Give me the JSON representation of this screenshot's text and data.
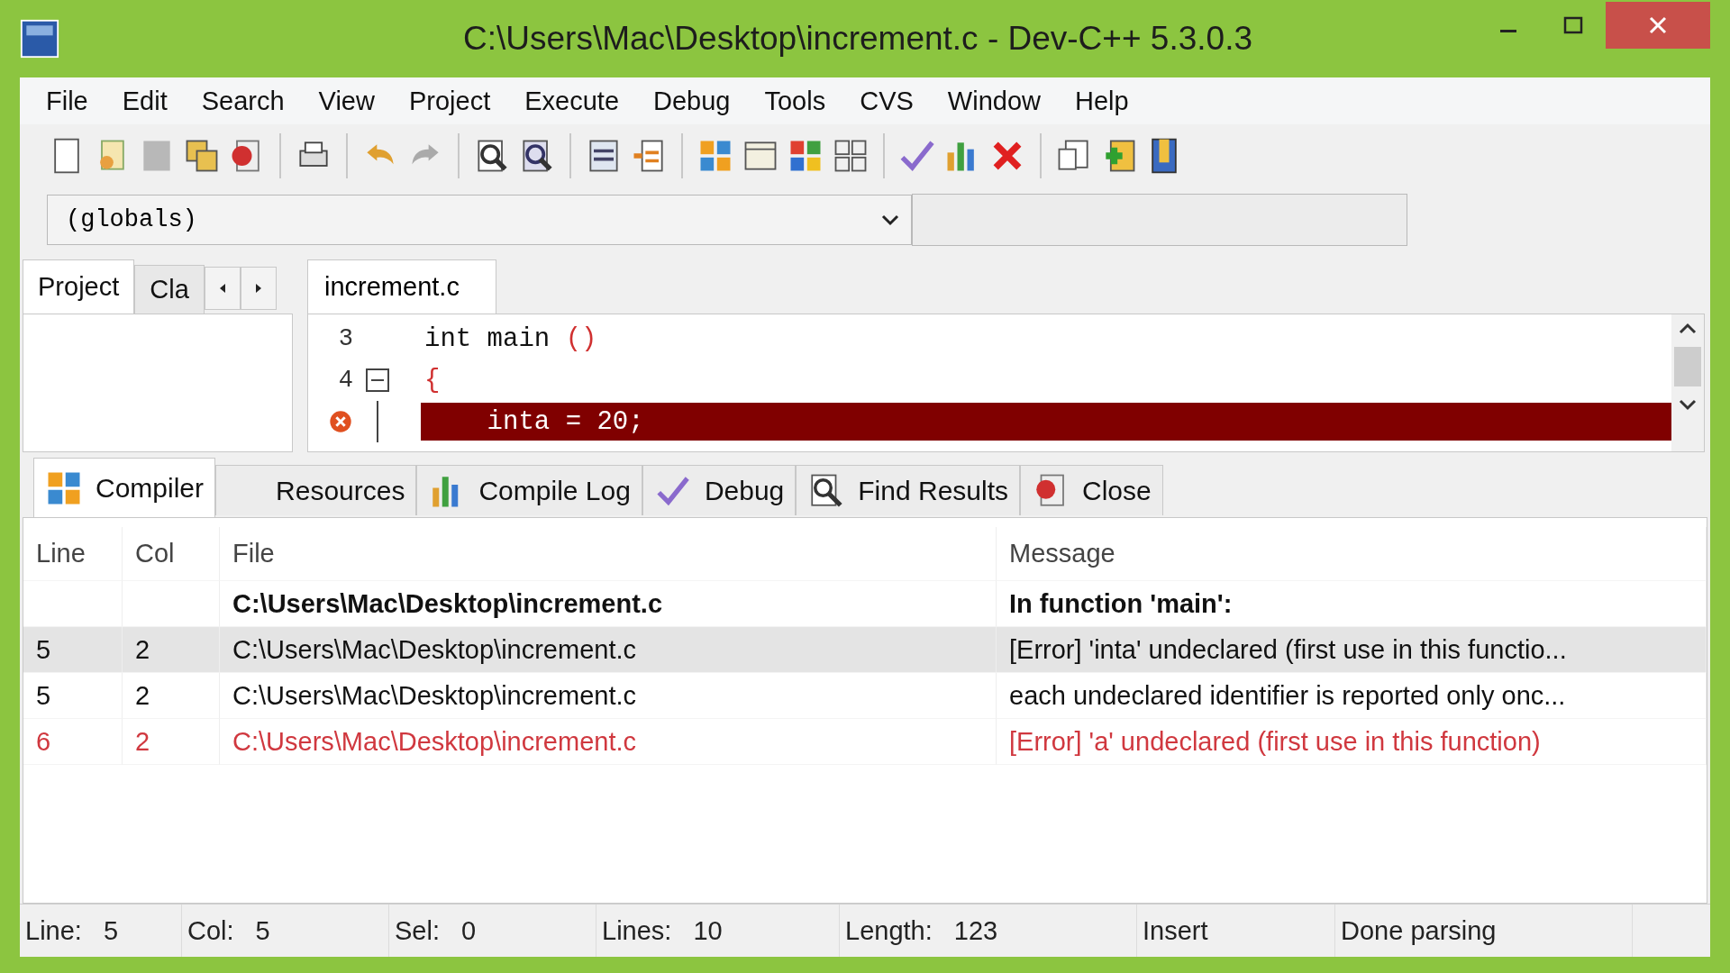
{
  "window": {
    "title": "C:\\Users\\Mac\\Desktop\\increment.c - Dev-C++ 5.3.0.3"
  },
  "menu": [
    "File",
    "Edit",
    "Search",
    "View",
    "Project",
    "Execute",
    "Debug",
    "Tools",
    "CVS",
    "Window",
    "Help"
  ],
  "scope_combo": {
    "value": "(globals)"
  },
  "left_tabs": [
    {
      "label": "Project",
      "selected": true
    },
    {
      "label": "Cla",
      "selected": false
    }
  ],
  "editor": {
    "tab": "increment.c",
    "lines": [
      {
        "number": "3",
        "fold": false,
        "error": false,
        "tokens": [
          {
            "kind": "plain",
            "text": "int main "
          },
          {
            "kind": "brace",
            "text": "()"
          }
        ]
      },
      {
        "number": "4",
        "fold": true,
        "error": false,
        "tokens": [
          {
            "kind": "brace",
            "text": "{"
          }
        ]
      },
      {
        "fold": false,
        "error": true,
        "tokens": [
          {
            "kind": "plain",
            "text": "    inta = 20;"
          }
        ]
      }
    ]
  },
  "bottom_tabs": [
    {
      "label": "Compiler",
      "selected": true
    },
    {
      "label": "Resources",
      "selected": false
    },
    {
      "label": "Compile Log",
      "selected": false
    },
    {
      "label": "Debug",
      "selected": false
    },
    {
      "label": "Find Results",
      "selected": false
    },
    {
      "label": "Close",
      "selected": false
    }
  ],
  "table": {
    "columns": [
      "Line",
      "Col",
      "File",
      "Message"
    ],
    "rows": [
      {
        "kind": "context",
        "selected": false,
        "line": "",
        "col": "",
        "file": "C:\\Users\\Mac\\Desktop\\increment.c",
        "message": "In function 'main':"
      },
      {
        "kind": "message",
        "selected": true,
        "line": "5",
        "col": "2",
        "file": "C:\\Users\\Mac\\Desktop\\increment.c",
        "message": "[Error] 'inta' undeclared (first use in this functio..."
      },
      {
        "kind": "message",
        "selected": false,
        "line": "5",
        "col": "2",
        "file": "C:\\Users\\Mac\\Desktop\\increment.c",
        "message": "each undeclared identifier is reported only onc..."
      },
      {
        "kind": "error",
        "selected": false,
        "line": "6",
        "col": "2",
        "file": "C:\\Users\\Mac\\Desktop\\increment.c",
        "message": "[Error] 'a' undeclared (first use in this function)"
      }
    ]
  },
  "status_bar": [
    {
      "label": "Line:",
      "value": "5"
    },
    {
      "label": "Col:",
      "value": "5"
    },
    {
      "label": "Sel:",
      "value": "0"
    },
    {
      "label": "Lines:",
      "value": "10"
    },
    {
      "label": "Length:",
      "value": "123"
    },
    {
      "label": "Insert"
    },
    {
      "label": "Done parsing"
    }
  ]
}
